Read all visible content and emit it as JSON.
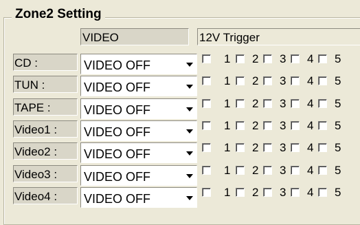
{
  "group": {
    "title": "Zone2 Setting"
  },
  "headers": {
    "video": "VIDEO",
    "trigger": "12V Trigger"
  },
  "checkbox_labels": [
    "1",
    "2",
    "3",
    "4",
    "5"
  ],
  "rows": [
    {
      "source": "CD :",
      "video": "VIDEO OFF"
    },
    {
      "source": "TUN :",
      "video": "VIDEO OFF"
    },
    {
      "source": "TAPE :",
      "video": "VIDEO OFF"
    },
    {
      "source": "Video1 :",
      "video": "VIDEO OFF"
    },
    {
      "source": "Video2 :",
      "video": "VIDEO OFF"
    },
    {
      "source": "Video3 :",
      "video": "VIDEO OFF"
    },
    {
      "source": "Video4 :",
      "video": "VIDEO OFF"
    }
  ]
}
